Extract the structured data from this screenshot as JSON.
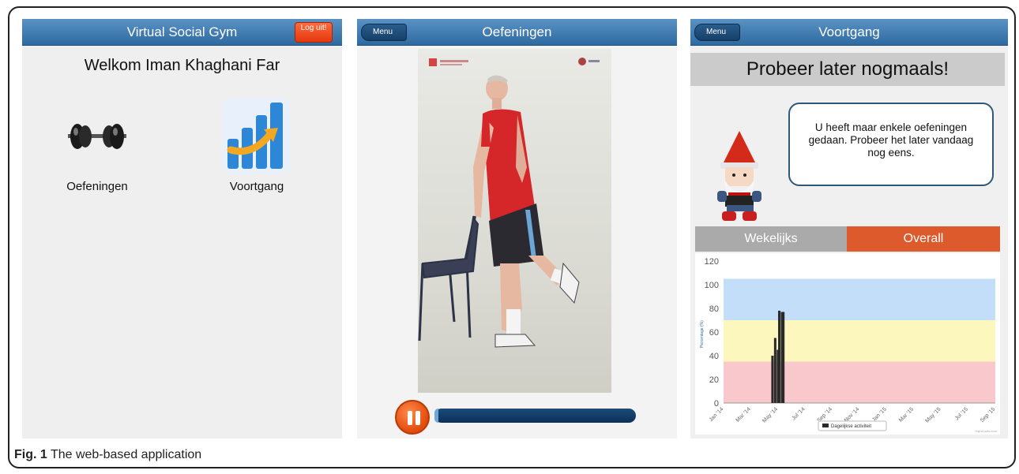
{
  "home": {
    "title": "Virtual Social Gym",
    "logout_label": "Log uit!",
    "welcome": "Welkom Iman Khaghani Far",
    "tiles": [
      {
        "label": "Oefeningen",
        "icon": "dumbbell-icon"
      },
      {
        "label": "Voortgang",
        "icon": "progress-chart-icon"
      }
    ]
  },
  "exercises": {
    "menu_label": "Menu",
    "title": "Oefeningen",
    "progress": 0.01
  },
  "progress_screen": {
    "menu_label": "Menu",
    "title": "Voortgang",
    "banner": "Probeer later nogmaals!",
    "message": "U heeft maar enkele oefeningen gedaan. Probeer het later vandaag nog eens.",
    "tabs": [
      {
        "label": "Wekelijks",
        "active": false
      },
      {
        "label": "Overall",
        "active": true
      }
    ]
  },
  "chart_data": {
    "type": "bar",
    "ylabel": "Percentage (%)",
    "ylim": [
      0,
      120
    ],
    "yticks": [
      0,
      20,
      40,
      60,
      80,
      100,
      120
    ],
    "xticks": [
      "Jan '14",
      "Mar '14",
      "May '14",
      "Jul '14",
      "Sep '14",
      "Nov '14",
      "Jan '15",
      "Mar '15",
      "May '15",
      "Jul '15",
      "Sep '15"
    ],
    "bands": [
      {
        "from": 0,
        "to": 35,
        "color": "#f8c8cc"
      },
      {
        "from": 35,
        "to": 70,
        "color": "#fbf7bd"
      },
      {
        "from": 70,
        "to": 105,
        "color": "#c3def8"
      }
    ],
    "series": [
      {
        "name": "Dagelijkse activiteit",
        "x_index": [
          1.8,
          1.9,
          2.0,
          2.05,
          2.15,
          2.2
        ],
        "values": [
          40,
          55,
          45,
          78,
          77,
          77
        ]
      }
    ],
    "legend": "bottom",
    "credit": "Highcharts.com"
  },
  "caption": {
    "label": "Fig. 1",
    "text": "The web-based application"
  },
  "colors": {
    "nav": "#3f7bb2",
    "accent": "#e2380d",
    "overall_tab": "#dd5a2d"
  }
}
